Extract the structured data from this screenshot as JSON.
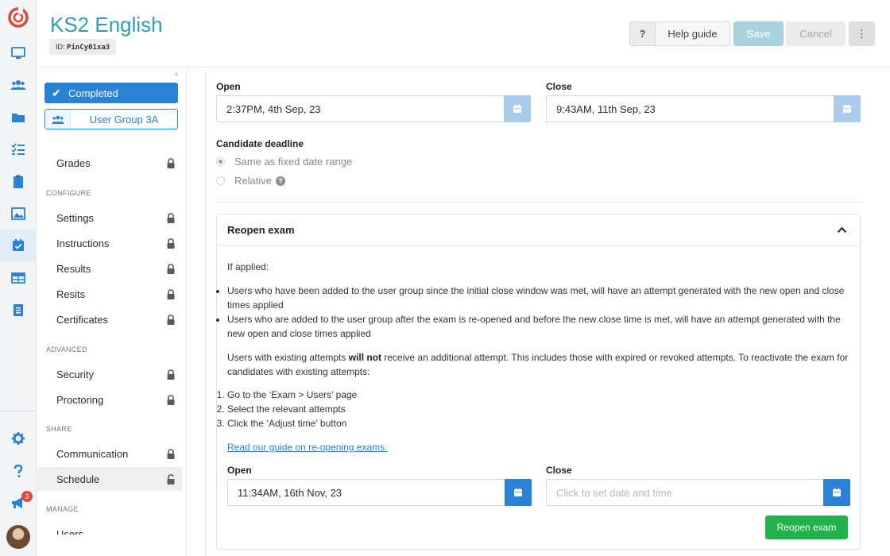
{
  "header": {
    "title": "KS2 English",
    "id_prefix": "ID:",
    "id_code": "PinCy01xa3",
    "help_q": "?",
    "help_guide": "Help guide",
    "save": "Save",
    "cancel": "Cancel",
    "more": "⋮"
  },
  "rail": {
    "icons": [
      "monitor-icon",
      "users-icon",
      "folder-icon",
      "checklist-icon",
      "clipboard-icon",
      "gallery-icon",
      "calendar-check-icon",
      "table-icon",
      "report-icon",
      "gear-icon",
      "help-icon",
      "megaphone-icon"
    ],
    "notification_count": "3",
    "active_index": 6
  },
  "sidebar": {
    "status": "Completed",
    "user_group": "User Group 3A",
    "collapse": "‹",
    "top_items": [
      {
        "label": "Grades",
        "locked": true
      }
    ],
    "sections": [
      {
        "title": "CONFIGURE",
        "items": [
          "Settings",
          "Instructions",
          "Results",
          "Resits",
          "Certificates"
        ]
      },
      {
        "title": "ADVANCED",
        "items": [
          "Security",
          "Proctoring"
        ]
      },
      {
        "title": "SHARE",
        "items": [
          "Communication",
          "Schedule"
        ]
      },
      {
        "title": "MANAGE",
        "items": [
          "Users"
        ]
      }
    ],
    "active_item": "Schedule"
  },
  "schedule": {
    "open_label": "Open",
    "open_value": "2:37PM, 4th Sep, 23",
    "close_label": "Close",
    "close_value": "9:43AM, 11th Sep, 23",
    "deadline_label": "Candidate deadline",
    "deadline_options": [
      "Same as fixed date range",
      "Relative"
    ],
    "deadline_selected": "Same as fixed date range",
    "relative_help": "?"
  },
  "reopen": {
    "title": "Reopen exam",
    "intro": "If applied:",
    "bullets": [
      "Users who have been added to the user group since the initial close window was met, will have an attempt generated with the new open and close times applied",
      "Users who are added to the user group after the exam is re-opened and before the new close time is met, will have an attempt generated with the new open and close times applied"
    ],
    "note_prefix": "Users with existing attempts ",
    "note_bold": "will not",
    "note_suffix": " receive an additional attempt. This includes those with expired or revoked attempts. To reactivate the exam for candidates with existing attempts:",
    "steps": [
      "Go to the ‘Exam > Users’ page",
      "Select the relevant attempts",
      "Click the ‘Adjust time’ button"
    ],
    "guide_link": "Read our guide on re-opening exams.",
    "open_label": "Open",
    "open_value": "11:34AM, 16th Nov, 23",
    "close_label": "Close",
    "close_placeholder": "Click to set date and time",
    "button": "Reopen exam"
  },
  "colors": {
    "accent": "#2b82d4",
    "title": "#2a9fb5",
    "success": "#22b24c",
    "save_disabled": "#a9d3e1",
    "logo": "#e0473c"
  }
}
